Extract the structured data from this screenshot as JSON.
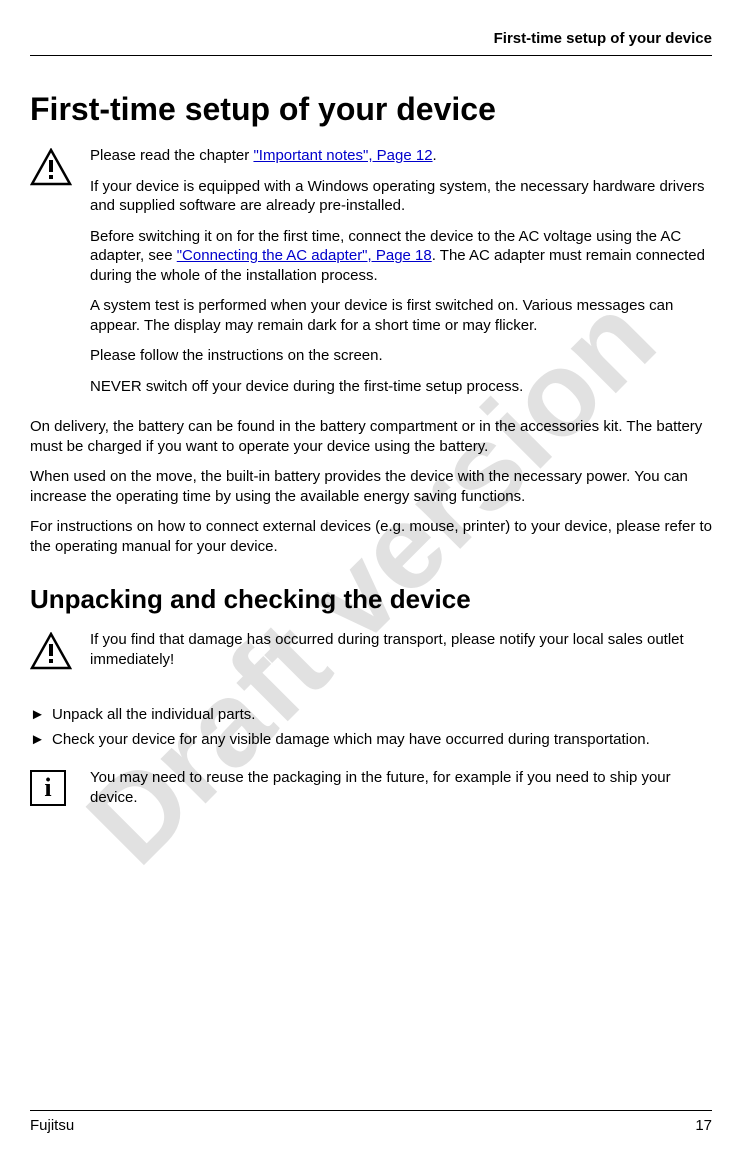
{
  "header": {
    "running_title": "First-time setup of your device"
  },
  "watermark": "Draft version",
  "section1": {
    "title": "First-time setup of your device",
    "warning": {
      "p1_pre": "Please read the chapter ",
      "p1_link": "\"Important notes\", Page 12",
      "p1_post": ".",
      "p2": "If your device is equipped with a Windows operating system, the necessary hardware drivers and supplied software are already pre-installed.",
      "p3_pre": "Before switching it on for the first time, connect the device to the AC voltage using the AC adapter, see ",
      "p3_link": "\"Connecting the AC adapter\", Page 18",
      "p3_post": ". The AC adapter must remain connected during the whole of the installation process.",
      "p4": "A system test is performed when your device is first switched on. Various messages can appear. The display may remain dark for a short time or may flicker.",
      "p5": "Please follow the instructions on the screen.",
      "p6": "NEVER switch off your device during the first-time setup process."
    },
    "body": {
      "p1": "On delivery, the battery can be found in the battery compartment or in the accessories kit. The battery must be charged if you want to operate your device using the battery.",
      "p2": "When used on the move, the built-in battery provides the device with the necessary power. You can increase the operating time by using the available energy saving functions.",
      "p3": "For instructions on how to connect external devices (e.g. mouse, printer) to your device, please refer to the operating manual for your device."
    }
  },
  "section2": {
    "title": "Unpacking and checking the device",
    "warning": {
      "p1": "If you find that damage has occurred during transport, please notify your local sales outlet immediately!"
    },
    "bullets": {
      "b1": "Unpack all the individual parts.",
      "b2": "Check your device for any visible damage which may have occurred during transportation."
    },
    "info": {
      "p1": "You may need to reuse the packaging in the future, for example if you need to ship your device."
    }
  },
  "footer": {
    "brand": "Fujitsu",
    "page": "17"
  },
  "icons": {
    "bullet": "►",
    "info_char": "i"
  }
}
